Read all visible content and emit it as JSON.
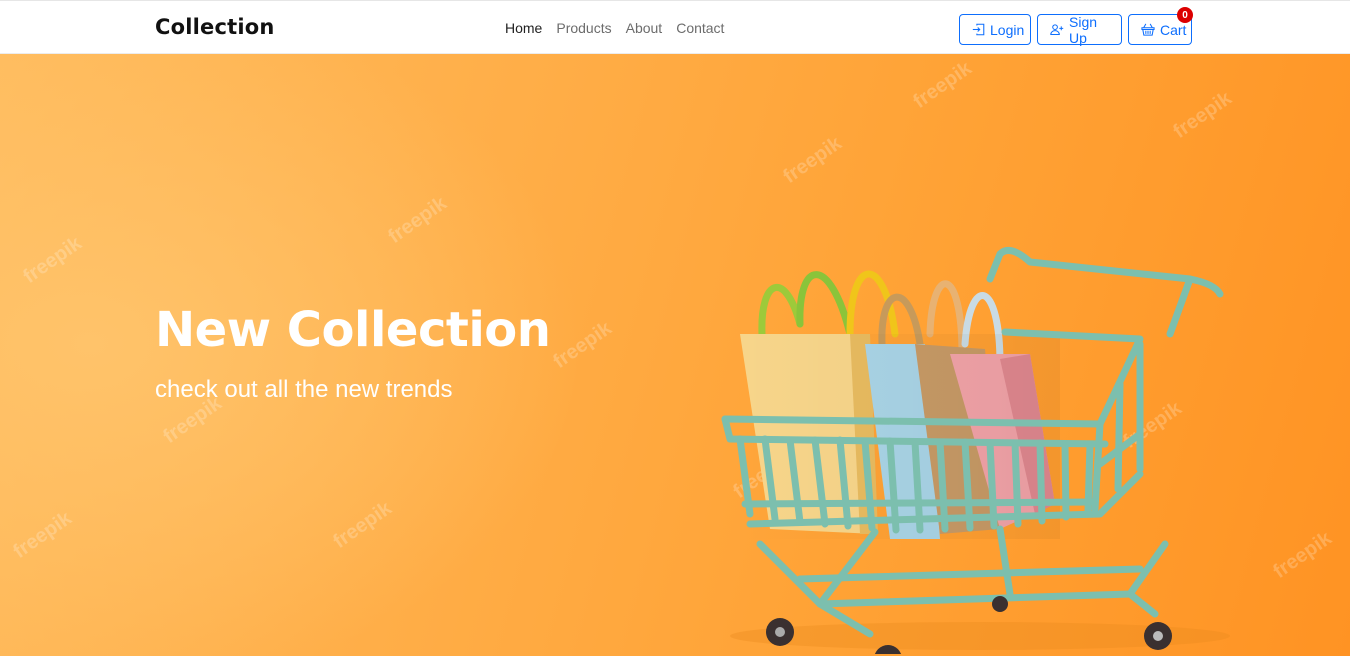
{
  "navbar": {
    "brand": "Collection",
    "links": [
      {
        "label": "Home",
        "active": true
      },
      {
        "label": "Products",
        "active": false
      },
      {
        "label": "About",
        "active": false
      },
      {
        "label": "Contact",
        "active": false
      }
    ],
    "actions": {
      "login_label": "Login",
      "login_icon": "login-icon",
      "signup_label": "Sign Up",
      "signup_icon": "user-plus-icon",
      "cart_label": "Cart",
      "cart_icon": "basket-icon",
      "cart_count": "0"
    }
  },
  "hero": {
    "title": "New Collection",
    "subtitle": "check out all the new trends",
    "image": "shopping-cart-with-bags",
    "watermark_text": "freepik"
  },
  "colors": {
    "accent": "#0d6efd",
    "badge": "#dc0000",
    "hero_bg": "#ffa235",
    "cart_frame": "#7cbfae"
  }
}
